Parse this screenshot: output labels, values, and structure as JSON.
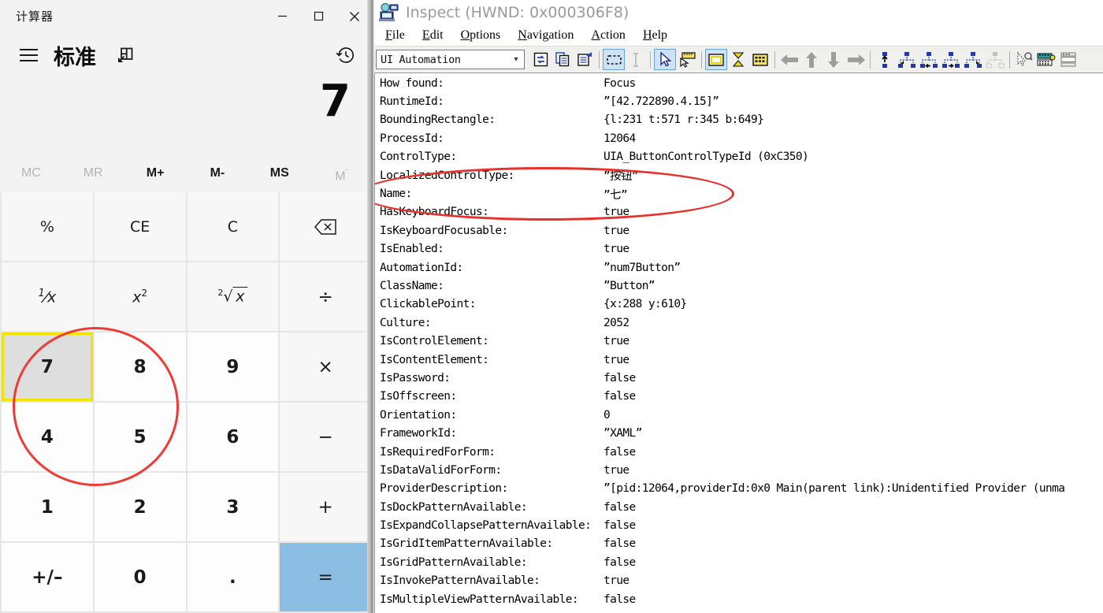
{
  "calculator": {
    "window_title": "计算器",
    "window_controls": [
      {
        "name": "minimize",
        "glyph": "minimize-icon"
      },
      {
        "name": "maximize",
        "glyph": "maximize-icon"
      },
      {
        "name": "close",
        "glyph": "close-icon"
      }
    ],
    "menu_icon": "hamburger-icon",
    "mode_title": "标准",
    "keep_on_top_icon": "keep-on-top-icon",
    "history_icon": "history-clock-icon",
    "display_value": "7",
    "memory_buttons": [
      {
        "label": "MC",
        "enabled": false
      },
      {
        "label": "MR",
        "enabled": false
      },
      {
        "label": "M+",
        "enabled": true
      },
      {
        "label": "M-",
        "enabled": true
      },
      {
        "label": "MS",
        "enabled": true
      },
      {
        "label": "M",
        "sup": "ˇ",
        "enabled": false
      }
    ],
    "keys": [
      {
        "label": "%",
        "kind": "fn",
        "name": "percent"
      },
      {
        "label": "CE",
        "kind": "fn",
        "name": "clear-entry"
      },
      {
        "label": "C",
        "kind": "fn",
        "name": "clear"
      },
      {
        "label": "backspace-icon",
        "kind": "fn",
        "name": "backspace",
        "icon": true
      },
      {
        "label": "1/x",
        "kind": "fn",
        "name": "reciprocal",
        "math": "recip"
      },
      {
        "label": "x2",
        "kind": "fn",
        "name": "square",
        "math": "square"
      },
      {
        "label": "2√x",
        "kind": "fn",
        "name": "square-root",
        "math": "sqrt"
      },
      {
        "label": "÷",
        "kind": "op",
        "name": "divide"
      },
      {
        "label": "7",
        "kind": "num",
        "name": "seven",
        "focused": true
      },
      {
        "label": "8",
        "kind": "num",
        "name": "eight"
      },
      {
        "label": "9",
        "kind": "num",
        "name": "nine"
      },
      {
        "label": "×",
        "kind": "op",
        "name": "multiply"
      },
      {
        "label": "4",
        "kind": "num",
        "name": "four"
      },
      {
        "label": "5",
        "kind": "num",
        "name": "five"
      },
      {
        "label": "6",
        "kind": "num",
        "name": "six"
      },
      {
        "label": "−",
        "kind": "op",
        "name": "subtract"
      },
      {
        "label": "1",
        "kind": "num",
        "name": "one"
      },
      {
        "label": "2",
        "kind": "num",
        "name": "two"
      },
      {
        "label": "3",
        "kind": "num",
        "name": "three"
      },
      {
        "label": "+",
        "kind": "op",
        "name": "add"
      },
      {
        "label": "+/–",
        "kind": "num",
        "name": "negate"
      },
      {
        "label": "0",
        "kind": "num",
        "name": "zero"
      },
      {
        "label": ".",
        "kind": "num",
        "name": "decimal"
      },
      {
        "label": "=",
        "kind": "equals",
        "name": "equals"
      }
    ]
  },
  "inspect": {
    "title": "Inspect  (HWND: 0x000306F8)",
    "title_icon": "inspect-monitor-icon",
    "menus": [
      {
        "label": "File",
        "accel": "F"
      },
      {
        "label": "Edit",
        "accel": "E"
      },
      {
        "label": "Options",
        "accel": "O"
      },
      {
        "label": "Navigation",
        "accel": "N"
      },
      {
        "label": "Action",
        "accel": "A"
      },
      {
        "label": "Help",
        "accel": "H"
      }
    ],
    "provider_combo": {
      "value": "UI Automation",
      "arrow": "chevron-down-icon"
    },
    "toolbar_icons": [
      {
        "name": "refresh-icon",
        "active": false
      },
      {
        "name": "copy-icon",
        "active": false
      },
      {
        "name": "properties-icon",
        "active": false
      },
      {
        "name": "select-rectangle-icon",
        "active": true
      },
      {
        "name": "text-cursor-icon",
        "active": false,
        "disabled": true
      },
      {
        "name": "pointer-arrow-icon",
        "active": true
      },
      {
        "name": "highlight-ruler-icon",
        "active": false
      },
      {
        "name": "rectangle-highlight-icon",
        "active": true
      },
      {
        "name": "hourglass-icon",
        "active": false
      },
      {
        "name": "grid-icon",
        "active": false
      },
      {
        "name": "nav-left-icon",
        "active": false,
        "disabled": true
      },
      {
        "name": "nav-up-icon",
        "active": false,
        "disabled": true
      },
      {
        "name": "nav-down-icon",
        "active": false,
        "disabled": true
      },
      {
        "name": "nav-right-icon",
        "active": false,
        "disabled": true
      },
      {
        "name": "tree-parent-icon",
        "active": false
      },
      {
        "name": "tree-first-child-icon",
        "active": false
      },
      {
        "name": "tree-previous-sibling-icon",
        "active": false
      },
      {
        "name": "tree-next-sibling-icon",
        "active": false
      },
      {
        "name": "tree-last-child-icon",
        "active": false
      },
      {
        "name": "tree-descend-icon",
        "active": false,
        "disabled": true
      },
      {
        "name": "watch-cursor-icon",
        "active": false
      },
      {
        "name": "keyboard-focus-icon",
        "active": false
      },
      {
        "name": "window-list-icon",
        "active": false
      }
    ],
    "properties": [
      {
        "key": "How found:",
        "value": "Focus"
      },
      {
        "key": "RuntimeId:",
        "value": "”[42.722890.4.15]”"
      },
      {
        "key": "BoundingRectangle:",
        "value": "{l:231 t:571 r:345 b:649}"
      },
      {
        "key": "ProcessId:",
        "value": "12064"
      },
      {
        "key": "ControlType:",
        "value": "UIA_ButtonControlTypeId (0xC350)"
      },
      {
        "key": "LocalizedControlType:",
        "value": "”按钮”"
      },
      {
        "key": "Name:",
        "value": "”七”"
      },
      {
        "key": "HasKeyboardFocus:",
        "value": "true"
      },
      {
        "key": "IsKeyboardFocusable:",
        "value": "true"
      },
      {
        "key": "IsEnabled:",
        "value": "true"
      },
      {
        "key": "AutomationId:",
        "value": "”num7Button”"
      },
      {
        "key": "ClassName:",
        "value": "”Button”"
      },
      {
        "key": "ClickablePoint:",
        "value": "{x:288 y:610}"
      },
      {
        "key": "Culture:",
        "value": "2052"
      },
      {
        "key": "IsControlElement:",
        "value": "true"
      },
      {
        "key": "IsContentElement:",
        "value": "true"
      },
      {
        "key": "IsPassword:",
        "value": "false"
      },
      {
        "key": "IsOffscreen:",
        "value": "false"
      },
      {
        "key": "Orientation:",
        "value": "0"
      },
      {
        "key": "FrameworkId:",
        "value": "”XAML”"
      },
      {
        "key": "IsRequiredForForm:",
        "value": "false"
      },
      {
        "key": "IsDataValidForForm:",
        "value": "true"
      },
      {
        "key": "ProviderDescription:",
        "value": "”[pid:12064,providerId:0x0 Main(parent link):Unidentified Provider  (unma"
      },
      {
        "key": "IsDockPatternAvailable:",
        "value": "false"
      },
      {
        "key": "IsExpandCollapsePatternAvailable:",
        "value": "false"
      },
      {
        "key": "IsGridItemPatternAvailable:",
        "value": "false"
      },
      {
        "key": "IsGridPatternAvailable:",
        "value": "false"
      },
      {
        "key": "IsInvokePatternAvailable:",
        "value": "true"
      },
      {
        "key": "IsMultipleViewPatternAvailable:",
        "value": "false"
      }
    ]
  },
  "annotations": {
    "ellipse_color": "#e8312a",
    "focus_outline_color": "#f2e200",
    "equals_highlight_color": "#8cbde3"
  }
}
